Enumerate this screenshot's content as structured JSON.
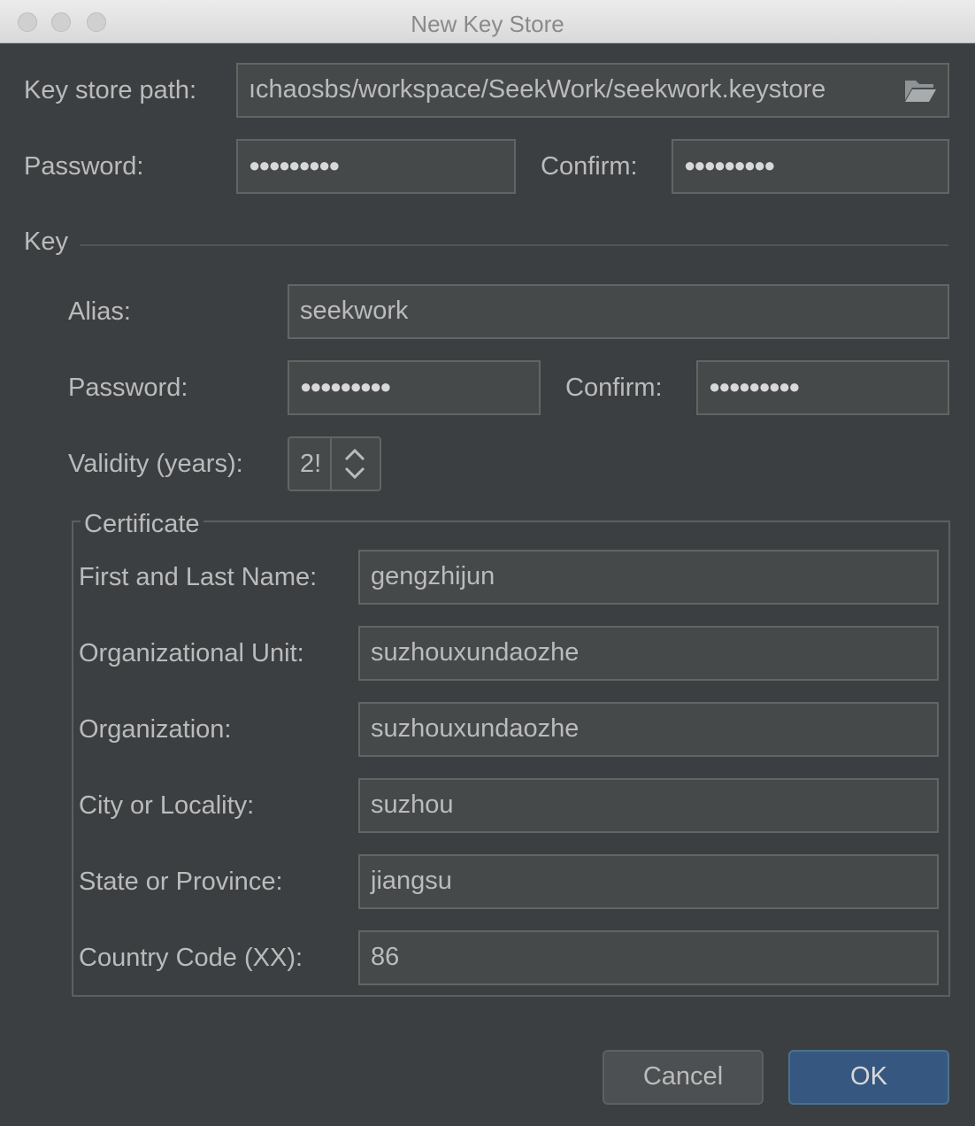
{
  "window": {
    "title": "New Key Store"
  },
  "keystore": {
    "path_label": "Key store path:",
    "path_value": "ıchaosbs/workspace/SeekWork/seekwork.keystore",
    "password_label": "Password:",
    "password_mask": "●●●●●●●●●",
    "confirm_label": "Confirm:",
    "confirm_mask": "●●●●●●●●●"
  },
  "key": {
    "section_label": "Key",
    "alias_label": "Alias:",
    "alias_value": "seekwork",
    "password_label": "Password:",
    "password_mask": "●●●●●●●●●",
    "confirm_label": "Confirm:",
    "confirm_mask": "●●●●●●●●●",
    "validity_label": "Validity (years):",
    "validity_value": "2!"
  },
  "certificate": {
    "legend": "Certificate",
    "name_label": "First and Last Name:",
    "name_value": "gengzhijun",
    "org_unit_label": "Organizational Unit:",
    "org_unit_value": "suzhouxundaozhe",
    "org_label": "Organization:",
    "org_value": "suzhouxundaozhe",
    "city_label": "City or Locality:",
    "city_value": "suzhou",
    "state_label": "State or Province:",
    "state_value": "jiangsu",
    "country_label": "Country Code (XX):",
    "country_value": "86"
  },
  "buttons": {
    "cancel": "Cancel",
    "ok": "OK"
  },
  "colors": {
    "background": "#3c3f41",
    "field": "#45494a",
    "ok_button": "#365880"
  },
  "icons": {
    "browse": "folder-icon",
    "spinner_up": "triangle-up-icon",
    "spinner_down": "triangle-down-icon"
  }
}
